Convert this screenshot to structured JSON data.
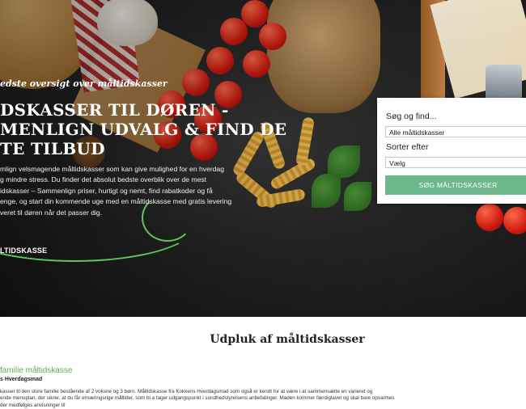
{
  "hero": {
    "tagline": "edste oversigt over måltidskasser",
    "headline_lines": [
      "DSKASSER TIL DØREN -",
      "MENLIGN UDVALG & FIND DE",
      "TE TILBUD"
    ],
    "intro_lines": [
      "mlign velsmagende måltidskasser som kan give mulighed for en hverdag",
      "g mindre stress. Du finder det absolut bedste overblik over de mest",
      "idskasser – Sammenlign priser, hurtigt og nemt, find rabatkoder og få",
      "enge, og start din kommende uge med en måltidskasse med gratis levering",
      "veret til døren når det passer dig."
    ],
    "cta_label": "LTIDSKASSE"
  },
  "search": {
    "title": "Søg og find...",
    "category_value": "Alle måltidskasser",
    "sort_label": "Sorter efter",
    "sort_value": "Vælg",
    "button_label": "SØG MÅLTIDSKASSER"
  },
  "featured": {
    "section_title": "Udpluk af måltidskasser",
    "card_title": "familie måltidskasse",
    "card_provider": "s Hverdagsmad",
    "card_desc_lines": [
      "kasser til den store familie bestående af 2 voksne og 3 børn. Måltidskasse fra Kokkens Hverdagsmad som også er kendt for at være i at sammensætte en varieret og",
      "ende menuplan, der sikrer, at du får ernæringsrige måltider, som bl.a tager udgangspunkt i sundhedstyrelsens anbefalinger. Maden kommer færdiglavet og skal bare opvarmes",
      "der medfølges anvisninger til"
    ]
  },
  "colors": {
    "accent_green": "#6cb88a",
    "link_green": "#5cad4a",
    "hero_dark": "#262626"
  }
}
